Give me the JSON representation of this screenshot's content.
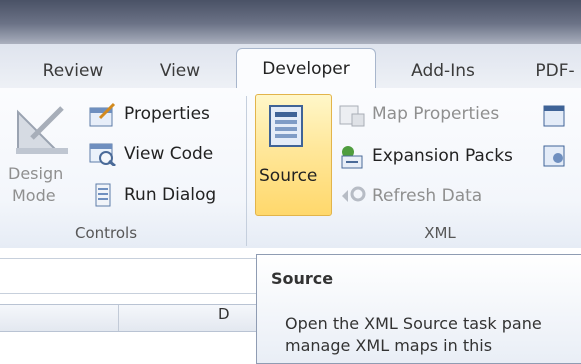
{
  "tabs": [
    {
      "label": "Review"
    },
    {
      "label": "View"
    },
    {
      "label": "Developer",
      "active": true
    },
    {
      "label": "Add-Ins"
    },
    {
      "label": "PDF-"
    }
  ],
  "controls": {
    "design_mode_line1": "Design",
    "design_mode_line2": "Mode",
    "properties": "Properties",
    "view_code": "View Code",
    "run_dialog": "Run Dialog",
    "group_label": "Controls"
  },
  "xml": {
    "source": "Source",
    "map_properties": "Map Properties",
    "expansion_packs": "Expansion Packs",
    "refresh_data": "Refresh Data",
    "group_label": "XML"
  },
  "sheet": {
    "column_header": "D"
  },
  "tooltip": {
    "title": "Source",
    "line1": "Open the XML Source task pane",
    "line2": "manage XML maps in this"
  },
  "colors": {
    "source_highlight": "#ffe08a",
    "tab_active_bg": "#fbfcfe"
  }
}
